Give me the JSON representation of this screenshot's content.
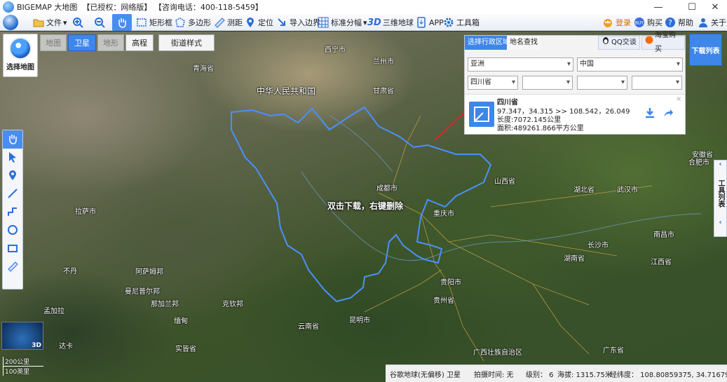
{
  "titlebar": {
    "title": "BIGEMAP 大地图  【已授权：网络版】 【咨询电话：400-118-5459】",
    "minimize": "—",
    "maximize": "☐",
    "close": "✕"
  },
  "toolbar": {
    "file": "文件",
    "rect": "矩形框",
    "polygon": "多边形",
    "measure": "测距",
    "locate": "定位",
    "import": "导入边界",
    "sheet": "标准分幅",
    "earth3d": "三维地球",
    "app": "APP",
    "toolbox": "工具箱",
    "login": "登录",
    "buy": "购买",
    "help": "帮助",
    "about": "关于"
  },
  "map_selector": {
    "label": "选择地图"
  },
  "map_tabs": [
    "地图",
    "卫星",
    "地形",
    "高程"
  ],
  "street_style": "街道样式",
  "admin_panel": {
    "tab_region": "选择行政区域",
    "tab_search": "地名查找",
    "qq": "QQ交谈",
    "taobao": "淘宝购买",
    "continent": "亚洲",
    "country": "中国",
    "province": "四川省",
    "info": {
      "name": "四川省",
      "bounds": "97.347，34.315 >> 108.542，26.049",
      "length": "长度:7072.145公里",
      "area": "面积:489261.866平方公里"
    }
  },
  "download_list": "下载列表",
  "toolbox_side": "工具列表",
  "hint": "双击下载，右键删除",
  "places": [
    "西宁市",
    "兰州市",
    "青海省",
    "中华人民共和国",
    "甘肃省",
    "宁夏回族自治区",
    "成都市",
    "重庆市",
    "拉萨市",
    "不丹",
    "昆明市",
    "贵阳市",
    "贵州省",
    "云南省",
    "湖北省",
    "武汉市",
    "长沙市",
    "湖南省",
    "江西省",
    "南昌市",
    "安徽省",
    "合肥市",
    "阿萨姆邦",
    "那加兰邦",
    "克钦邦",
    "曼尼普尔邦",
    "缅甸",
    "实皆省",
    "广西壮族自治区",
    "广东省",
    "山西省",
    "达卡",
    "孟加拉"
  ],
  "statusbar": {
    "source": "谷歌地球(无偏移) 卫星",
    "capture": "拍摄时间: 无",
    "level": "级别： 6",
    "altitude": "海拔: 1315.75米",
    "longlat": "经纬度： 108.80859375, 34.71679688"
  },
  "scale": {
    "top": "200公里",
    "bottom": "100英里"
  },
  "overview_label": "3D",
  "colors": {
    "accent": "#3e86ea",
    "boundary": "#4a90ff",
    "annotation": "#e0252a"
  }
}
